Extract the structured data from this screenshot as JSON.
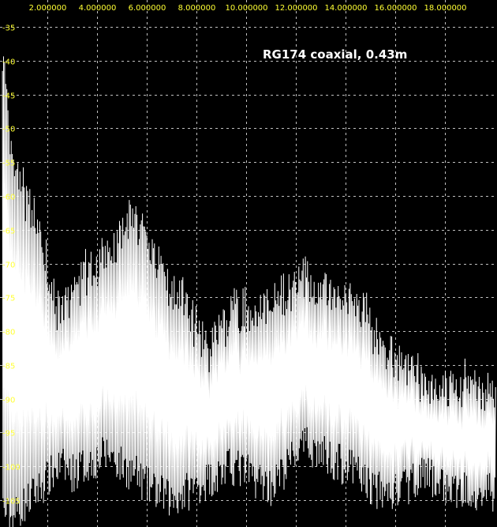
{
  "chart_data": {
    "type": "line",
    "title": "RG174 coaxial, 0.43m",
    "xlabel": "",
    "ylabel": "",
    "x_ticks": [
      "2.000000",
      "4.000000",
      "6.000000",
      "8.000000",
      "10.000000",
      "12.000000",
      "14.000000",
      "16.000000",
      "18.000000"
    ],
    "y_ticks": [
      "-35",
      "-40",
      "-45",
      "-50",
      "-55",
      "-60",
      "-65",
      "-70",
      "-75",
      "-80",
      "-85",
      "-90",
      "-95",
      "-100",
      "-105"
    ],
    "xlim": [
      0.1,
      20.1
    ],
    "ylim": [
      -109,
      -31
    ],
    "grid": true,
    "colors": {
      "background": "#000000",
      "trace": "#ffffff",
      "ticks": "#ffff33",
      "grid": "#ffffff",
      "title": "#ffffff"
    },
    "series": [
      {
        "x": [
          0.2,
          0.5,
          1.0,
          1.5,
          2.0,
          2.5,
          3.0,
          3.5,
          4.0,
          4.5,
          5.0,
          5.5,
          6.0,
          6.5,
          7.0,
          7.5,
          8.0,
          8.5,
          9.0,
          9.5,
          10.0,
          10.5,
          11.0,
          11.5,
          12.0,
          12.5,
          13.0,
          13.5,
          14.0,
          14.5,
          15.0,
          15.5,
          16.0,
          16.5,
          17.0,
          17.5,
          18.0,
          18.5,
          19.0,
          19.5,
          20.0
        ],
        "upper": [
          -40,
          -54,
          -61,
          -66,
          -72,
          -80,
          -77,
          -74,
          -72,
          -70,
          -68,
          -65,
          -68,
          -72,
          -76,
          -77,
          -82,
          -85,
          -82,
          -79,
          -79,
          -78,
          -79,
          -77,
          -75,
          -74,
          -76,
          -77,
          -78,
          -78,
          -81,
          -85,
          -86,
          -87,
          -89,
          -90,
          -90,
          -91,
          -90,
          -91,
          -90
        ],
        "lower": [
          -106,
          -108,
          -106,
          -104,
          -102,
          -100,
          -101,
          -100,
          -99,
          -98,
          -100,
          -101,
          -103,
          -104,
          -105,
          -104,
          -103,
          -102,
          -101,
          -100,
          -101,
          -102,
          -103,
          -101,
          -98,
          -97,
          -98,
          -99,
          -100,
          -101,
          -103,
          -104,
          -104,
          -103,
          -101,
          -102,
          -103,
          -104,
          -103,
          -104,
          -104
        ]
      }
    ]
  }
}
